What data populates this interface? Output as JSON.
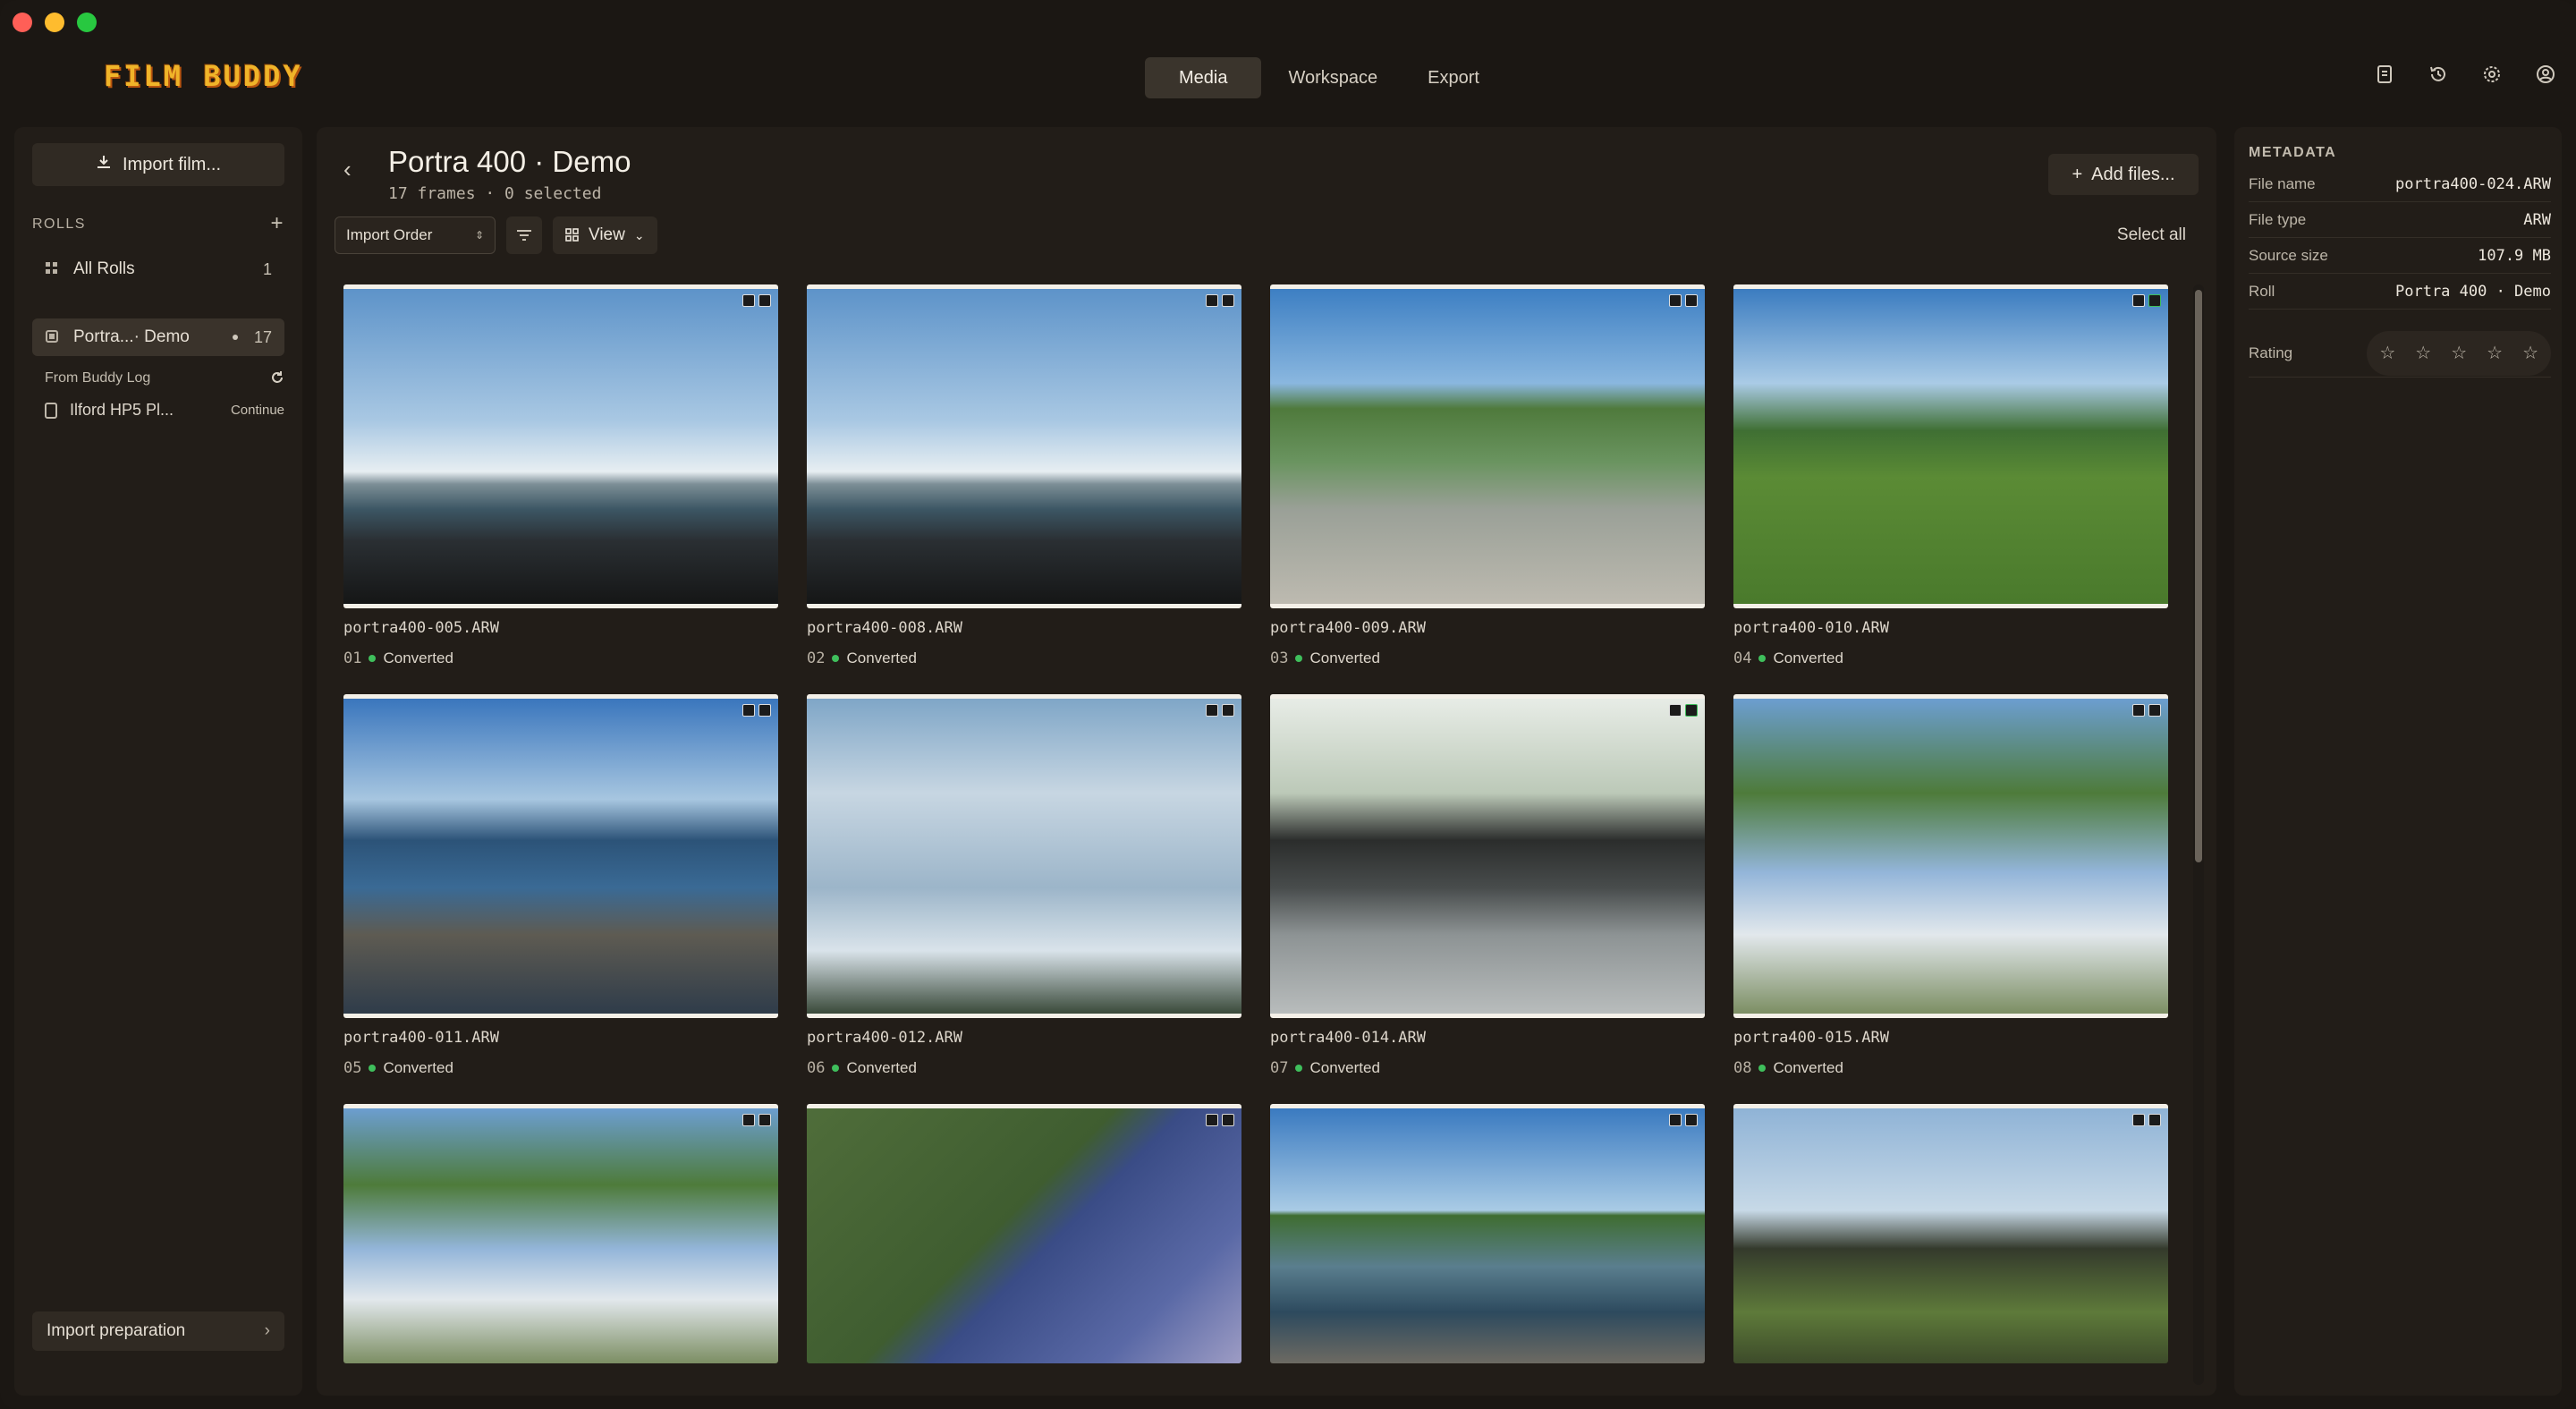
{
  "app": {
    "logo": "FILM BUDDY"
  },
  "top_tabs": [
    {
      "label": "Media",
      "active": true
    },
    {
      "label": "Workspace",
      "active": false
    },
    {
      "label": "Export",
      "active": false
    }
  ],
  "sidebar": {
    "import_label": "Import film...",
    "rolls_header": "ROLLS",
    "all_rolls": {
      "label": "All Rolls",
      "count": "1"
    },
    "active_roll": {
      "label": "Portra...· Demo",
      "count": "17"
    },
    "buddy_log_header": "From Buddy Log",
    "buddy_item": {
      "label": "Ilford HP5 Pl...",
      "action": "Continue"
    },
    "prep_label": "Import preparation"
  },
  "main": {
    "title": "Portra 400 · Demo",
    "subtitle": "17 frames · 0 selected",
    "add_files": "Add files...",
    "sort_value": "Import Order",
    "view_label": "View",
    "select_all": "Select all"
  },
  "frames": [
    {
      "file": "portra400-005.ARW",
      "num": "01",
      "status": "Converted",
      "scene": "s-lighthouse"
    },
    {
      "file": "portra400-008.ARW",
      "num": "02",
      "status": "Converted",
      "scene": "s-lighthouse"
    },
    {
      "file": "portra400-009.ARW",
      "num": "03",
      "status": "Converted",
      "scene": "s-park1"
    },
    {
      "file": "portra400-010.ARW",
      "num": "04",
      "status": "Converted",
      "scene": "s-park2"
    },
    {
      "file": "portra400-011.ARW",
      "num": "05",
      "status": "Converted",
      "scene": "s-waves"
    },
    {
      "file": "portra400-012.ARW",
      "num": "06",
      "status": "Converted",
      "scene": "s-clouds"
    },
    {
      "file": "portra400-014.ARW",
      "num": "07",
      "status": "Converted",
      "scene": "s-bench"
    },
    {
      "file": "portra400-015.ARW",
      "num": "08",
      "status": "Converted",
      "scene": "s-treehouse"
    },
    {
      "file": "",
      "num": "",
      "status": "",
      "scene": "s-treehouse"
    },
    {
      "file": "",
      "num": "",
      "status": "",
      "scene": "s-flower"
    },
    {
      "file": "",
      "num": "",
      "status": "",
      "scene": "s-shore"
    },
    {
      "file": "",
      "num": "",
      "status": "",
      "scene": "s-trees"
    }
  ],
  "metadata": {
    "header": "METADATA",
    "file_name": {
      "label": "File name",
      "value": "portra400-024.ARW"
    },
    "file_type": {
      "label": "File type",
      "value": "ARW"
    },
    "source_size": {
      "label": "Source size",
      "value": "107.9 MB"
    },
    "roll": {
      "label": "Roll",
      "value": "Portra 400 · Demo"
    },
    "rating": {
      "label": "Rating",
      "value": 0,
      "max": 5
    }
  },
  "colors": {
    "accent": "#3fbf5c",
    "logo": "#f0b429",
    "background": "#1b1713"
  }
}
